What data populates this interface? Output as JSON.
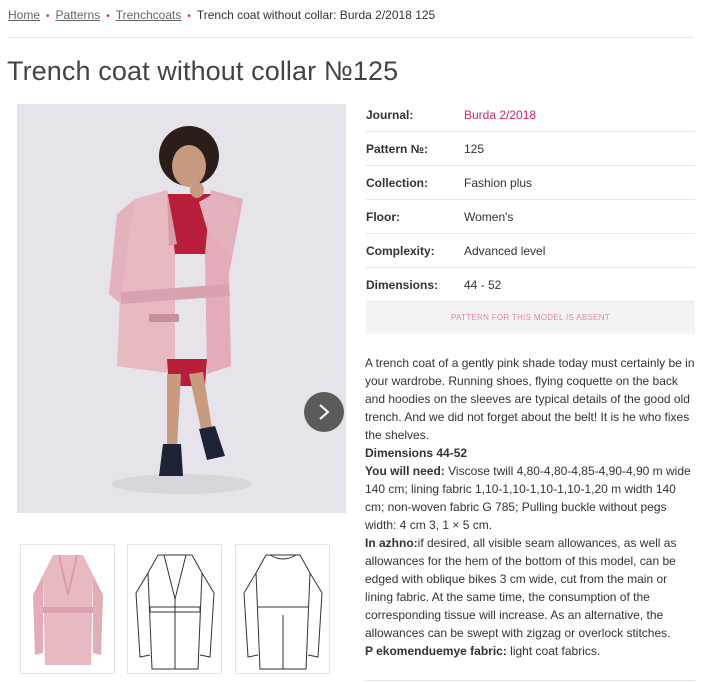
{
  "breadcrumb": {
    "items": [
      "Home",
      "Patterns",
      "Trenchcoats"
    ],
    "current": "Trench coat without collar: Burda 2/2018 125",
    "separator": "•"
  },
  "page_title": "Trench coat without collar №125",
  "details": [
    {
      "label": "Journal:",
      "value": "Burda 2/2018",
      "is_link": true
    },
    {
      "label": "Pattern №:",
      "value": "125",
      "is_link": false
    },
    {
      "label": "Collection:",
      "value": "Fashion plus",
      "is_link": false
    },
    {
      "label": "Floor:",
      "value": "Women's",
      "is_link": false
    },
    {
      "label": "Complexity:",
      "value": "Advanced level",
      "is_link": false
    },
    {
      "label": "Dimensions:",
      "value": "44 - 52",
      "is_link": false
    }
  ],
  "absent_button": "PATTERN FOR THIS MODEL IS ABSENT",
  "description": {
    "intro": "A trench coat of a gently pink shade today must certainly be in your wardrobe. Running shoes, flying coquette on the back and hoodies on the sleeves are typical details of the good old trench. And we did not forget about the belt! It is he who fixes the shelves.",
    "dimensions_heading": "Dimensions 44-52",
    "you_will_need_label": "You will need:",
    "you_will_need_text": " Viscose twill 4,80-4,80-4,85-4,90-4,90 m wide 140 cm; lining fabric 1,10-1,10-1,10-1,10-1,20 m width 140 cm; non-woven fabric G 785; Pulling buckle without pegs width: 4 cm 3, 1 × 5 cm.",
    "in_azhno_label": "In azhno:",
    "in_azhno_text": "if desired, all visible seam allowances, as well as allowances for the hem of the bottom of this model, can be edged with oblique bikes 3 cm wide, cut from the main or lining fabric. At the same time, the consumption of the corresponding tissue will increase. As an alternative, the allowances can be swept with zigzag or overlock stitches.",
    "fabric_label": "P ekomenduemye fabric:",
    "fabric_text": " light coat fabrics."
  },
  "colors": {
    "accent": "#d6246e",
    "coat": "#e9b9c2",
    "photo_bg": "#e6e4ea",
    "nav_button": "#5a5a5a"
  },
  "icons": {
    "next": "chevron-right-icon"
  }
}
